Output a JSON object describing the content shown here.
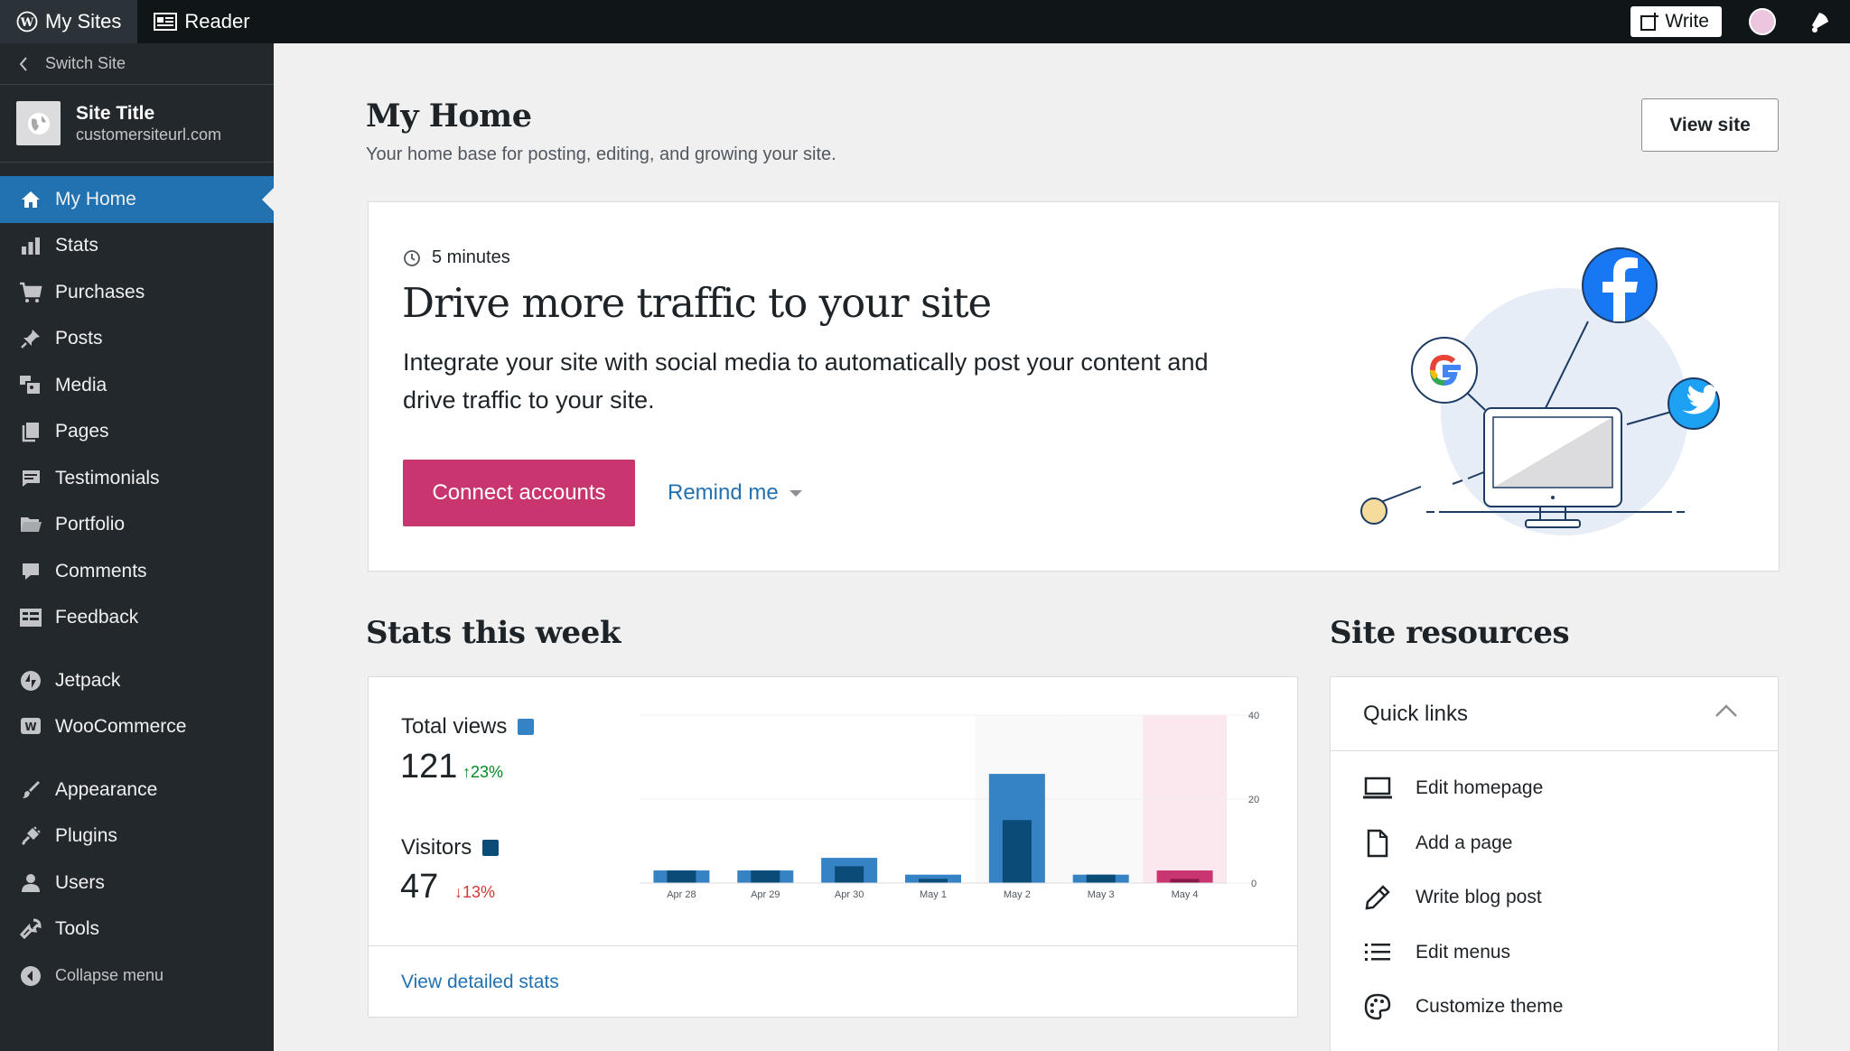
{
  "topbar": {
    "my_sites": "My Sites",
    "reader": "Reader",
    "write": "Write",
    "avatar_color": "#ecc6df"
  },
  "sidebar": {
    "switch_site": "Switch Site",
    "site_title": "Site Title",
    "site_url": "customersiteurl.com",
    "items": [
      {
        "label": "My Home",
        "icon": "home-icon",
        "active": true
      },
      {
        "label": "Stats",
        "icon": "stats-icon"
      },
      {
        "label": "Purchases",
        "icon": "cart-icon"
      },
      {
        "label": "Posts",
        "icon": "pin-icon"
      },
      {
        "label": "Media",
        "icon": "media-icon"
      },
      {
        "label": "Pages",
        "icon": "pages-icon"
      },
      {
        "label": "Testimonials",
        "icon": "testimonials-icon"
      },
      {
        "label": "Portfolio",
        "icon": "portfolio-icon"
      },
      {
        "label": "Comments",
        "icon": "comments-icon"
      },
      {
        "label": "Feedback",
        "icon": "feedback-icon"
      },
      {
        "label": "Jetpack",
        "icon": "jetpack-icon"
      },
      {
        "label": "WooCommerce",
        "icon": "woocommerce-icon"
      },
      {
        "label": "Appearance",
        "icon": "appearance-icon"
      },
      {
        "label": "Plugins",
        "icon": "plugins-icon"
      },
      {
        "label": "Users",
        "icon": "users-icon"
      },
      {
        "label": "Tools",
        "icon": "tools-icon"
      }
    ],
    "collapse": "Collapse menu",
    "active_color": "#2271b1"
  },
  "header": {
    "title": "My Home",
    "subtitle": "Your home base for posting, editing, and growing your site.",
    "view_site": "View site"
  },
  "task": {
    "time": "5 minutes",
    "title": "Drive more traffic to your site",
    "description": "Integrate your site with social media to automatically post your content and drive traffic to your site.",
    "primary": "Connect accounts",
    "secondary": "Remind me",
    "primary_color": "#c9356e"
  },
  "stats": {
    "heading": "Stats this week",
    "views_label": "Total views",
    "views_value": "121",
    "views_delta": "23%",
    "visitors_label": "Visitors",
    "visitors_value": "47",
    "visitors_delta": "13%",
    "footer_link": "View detailed stats"
  },
  "chart_data": {
    "type": "bar",
    "categories": [
      "Apr 28",
      "Apr 29",
      "Apr 30",
      "May 1",
      "May 2",
      "May 3",
      "May 4"
    ],
    "series": [
      {
        "name": "Total views",
        "values": [
          3,
          3,
          6,
          2,
          26,
          2,
          3
        ],
        "color": "#3582c4"
      },
      {
        "name": "Visitors",
        "values": [
          3,
          3,
          4,
          1,
          15,
          2,
          1
        ],
        "color": "#0a4b78"
      }
    ],
    "yticks": [
      "0",
      "20",
      "40"
    ],
    "ylim": [
      0,
      40
    ],
    "highlight_today_color": "#c9356e"
  },
  "resources": {
    "heading": "Site resources",
    "quick_links_title": "Quick links",
    "links": [
      {
        "label": "Edit homepage",
        "icon": "laptop-icon"
      },
      {
        "label": "Add a page",
        "icon": "page-icon"
      },
      {
        "label": "Write blog post",
        "icon": "pencil-icon"
      },
      {
        "label": "Edit menus",
        "icon": "list-icon"
      },
      {
        "label": "Customize theme",
        "icon": "palette-icon"
      }
    ]
  }
}
